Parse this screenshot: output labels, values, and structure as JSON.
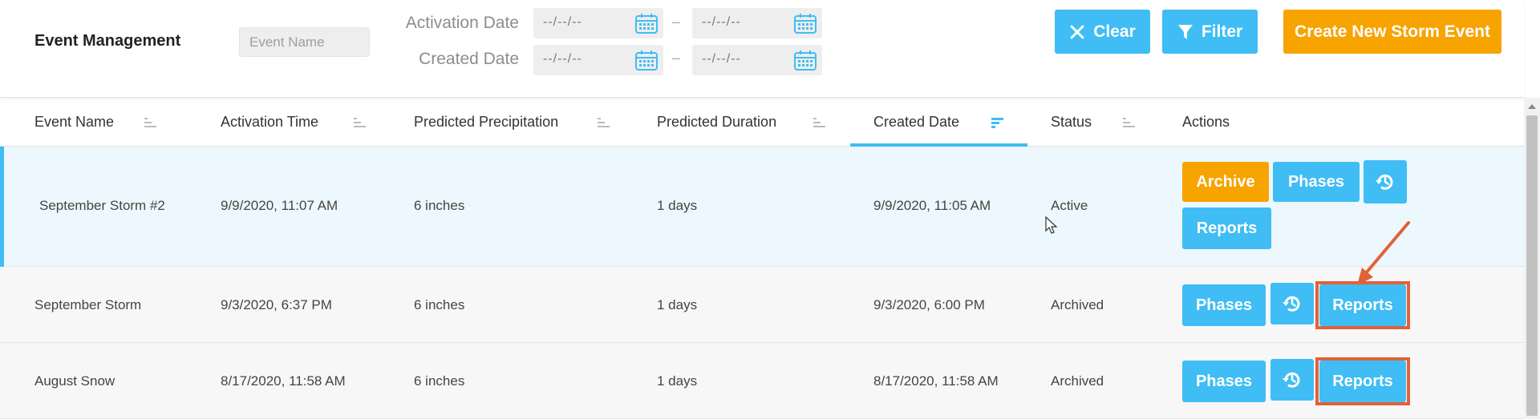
{
  "header": {
    "title": "Event Management",
    "event_name_placeholder": "Event Name",
    "activation_date_label": "Activation Date",
    "created_date_label": "Created Date",
    "date_placeholder": "--/--/--",
    "range_separator": "–",
    "clear_label": "Clear",
    "filter_label": "Filter",
    "create_label": "Create New Storm Event"
  },
  "table": {
    "columns": [
      "Event Name",
      "Activation Time",
      "Predicted Precipitation",
      "Predicted Duration",
      "Created Date",
      "Status",
      "Actions"
    ],
    "rows": [
      {
        "event_name": "September Storm #2",
        "activation_time": "9/9/2020, 11:07 AM",
        "precipitation": "6 inches",
        "duration": "1 days",
        "created_date": "9/9/2020, 11:05 AM",
        "status": "Active",
        "actions": {
          "archive": "Archive",
          "phases": "Phases",
          "reports": "Reports"
        }
      },
      {
        "event_name": "September Storm",
        "activation_time": "9/3/2020, 6:37 PM",
        "precipitation": "6 inches",
        "duration": "1 days",
        "created_date": "9/3/2020, 6:00 PM",
        "status": "Archived",
        "actions": {
          "phases": "Phases",
          "reports": "Reports"
        }
      },
      {
        "event_name": "August Snow",
        "activation_time": "8/17/2020, 11:58 AM",
        "precipitation": "6 inches",
        "duration": "1 days",
        "created_date": "8/17/2020, 11:58 AM",
        "status": "Archived",
        "actions": {
          "phases": "Phases",
          "reports": "Reports"
        }
      }
    ]
  },
  "colors": {
    "accent_blue": "#3fbdf4",
    "accent_orange": "#f7a300",
    "annotation_red": "#e0623a"
  },
  "icons": [
    "calendar-icon",
    "close-icon",
    "filter-icon",
    "sort-icon",
    "sort-active-icon",
    "history-icon"
  ]
}
